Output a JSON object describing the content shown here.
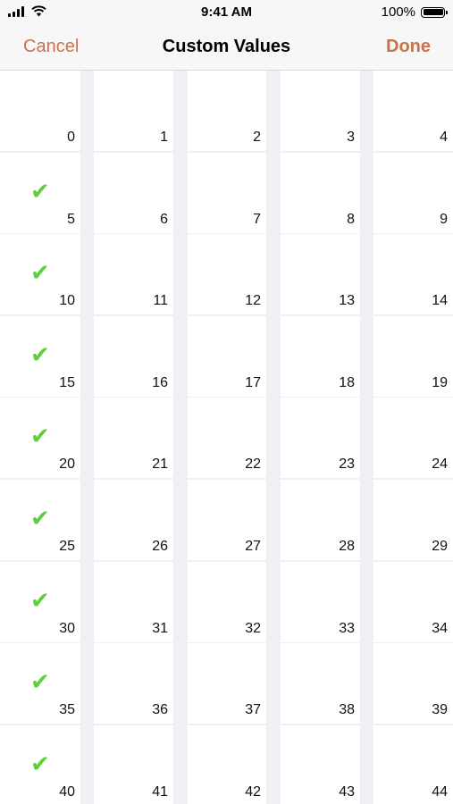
{
  "status": {
    "time": "9:41 AM",
    "battery": "100%"
  },
  "nav": {
    "cancel": "Cancel",
    "title": "Custom Values",
    "done": "Done"
  },
  "accent_color": "#c8734a",
  "check_color": "#5fcf3c",
  "check_icon": "✔",
  "grid": {
    "columns": 5,
    "values": [
      "0",
      "1",
      "2",
      "3",
      "4",
      "5",
      "6",
      "7",
      "8",
      "9",
      "10",
      "11",
      "12",
      "13",
      "14",
      "15",
      "16",
      "17",
      "18",
      "19",
      "20",
      "21",
      "22",
      "23",
      "24",
      "25",
      "26",
      "27",
      "28",
      "29",
      "30",
      "31",
      "32",
      "33",
      "34",
      "35",
      "36",
      "37",
      "38",
      "39",
      "40",
      "41",
      "42",
      "43",
      "44"
    ],
    "checked": [
      "5",
      "10",
      "15",
      "20",
      "25",
      "30",
      "35",
      "40"
    ]
  }
}
